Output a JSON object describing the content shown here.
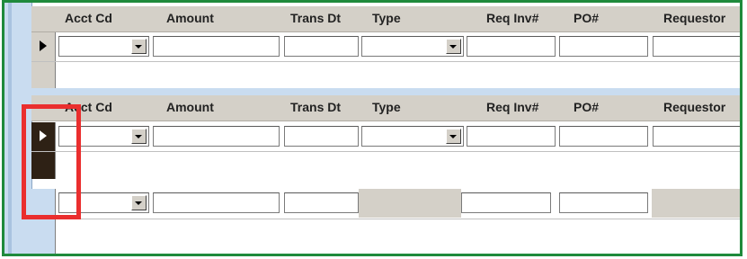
{
  "columns": [
    "Acct Cd",
    "Amount",
    "Trans Dt",
    "Type",
    "Req Inv#",
    "PO#",
    "Requestor"
  ],
  "sections": [
    {
      "header": [
        "Acct Cd",
        "Amount",
        "Trans Dt",
        "Type",
        "Req Inv#",
        "PO#",
        "Requestor"
      ],
      "current_row_indicator": "record-selector-arrow"
    },
    {
      "header": [
        "Acct Cd",
        "Amount",
        "Trans Dt",
        "Type",
        "Req Inv#",
        "PO#",
        "Requestor"
      ],
      "current_row_indicator": "record-selector-arrow",
      "highlighted": true
    }
  ],
  "icons": {
    "dropdown": "chevron-down-icon",
    "record_selector": "play-triangle-icon"
  },
  "colors": {
    "frame_border": "#1f8a3c",
    "highlight_box": "#ea2e2e",
    "header_bg": "#d4d0c8",
    "left_strip": "#c9dcf0",
    "selected_selector_bg": "#2e2115"
  }
}
